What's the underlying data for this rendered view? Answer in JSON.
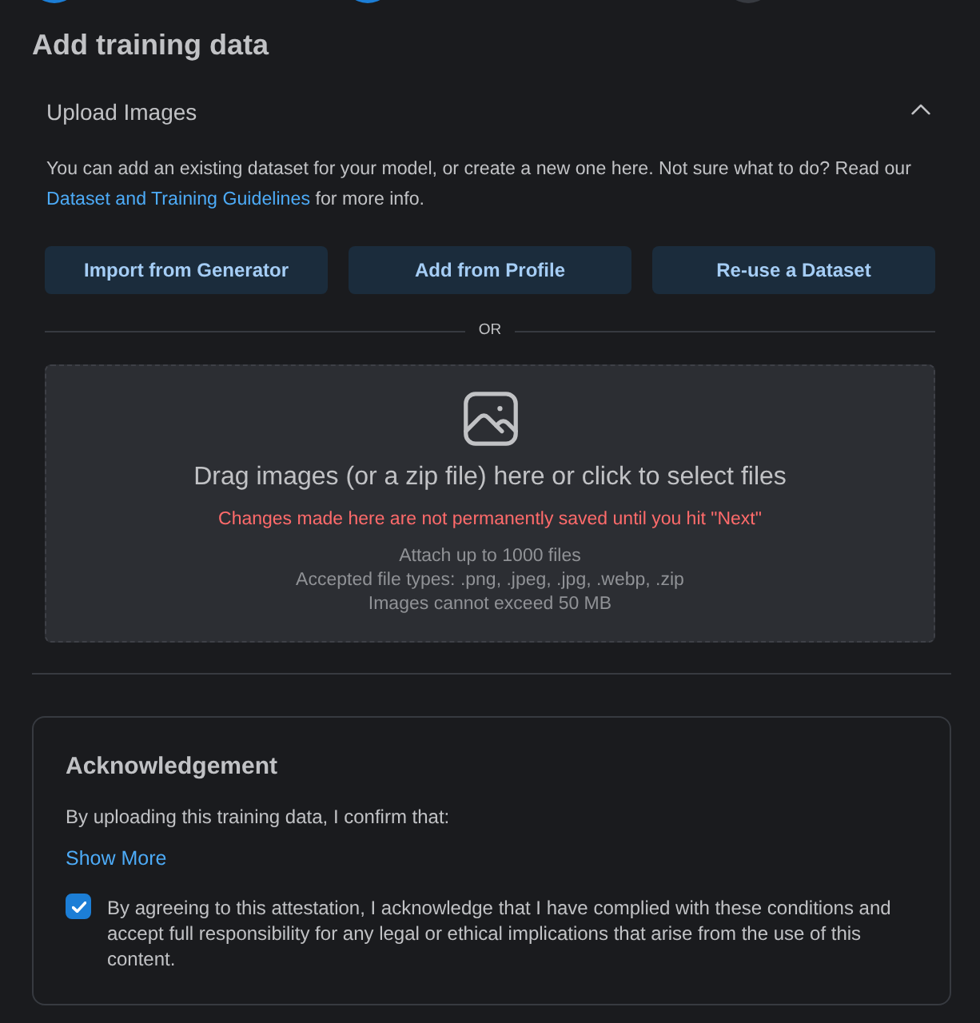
{
  "steps": [
    {
      "completed": true
    },
    {
      "completed": true
    },
    {
      "completed": false
    }
  ],
  "page": {
    "title": "Add training data"
  },
  "upload_section": {
    "title": "Upload Images",
    "expanded": true,
    "description": "You can add an existing dataset for your model, or create a new one here. Not sure what to do? Read our",
    "link": "Dataset and Training Guidelines",
    "description_end": "for more info.",
    "buttons": [
      "Import from Generator",
      "Add from Profile",
      "Re-use a Dataset"
    ],
    "divider_label": "OR",
    "dropzone": {
      "title": "Drag images (or a zip file) here or click to select files",
      "warning": "Changes made here are not permanently saved until you hit \"Next\"",
      "details": [
        "Attach up to 1000 files",
        "Accepted file types: .png, .jpeg, .jpg, .webp, .zip",
        "Images cannot exceed 50 MB"
      ]
    }
  },
  "acknowledgement": {
    "title": "Acknowledgement",
    "intro": "By uploading this training data, I confirm that:",
    "show_more": "Show More",
    "attestation": {
      "label": "By agreeing to this attestation, I acknowledge that I have complied with these conditions and accept full responsibility for any legal or ethical implications that arise from the use of this content.",
      "checked": true
    }
  }
}
